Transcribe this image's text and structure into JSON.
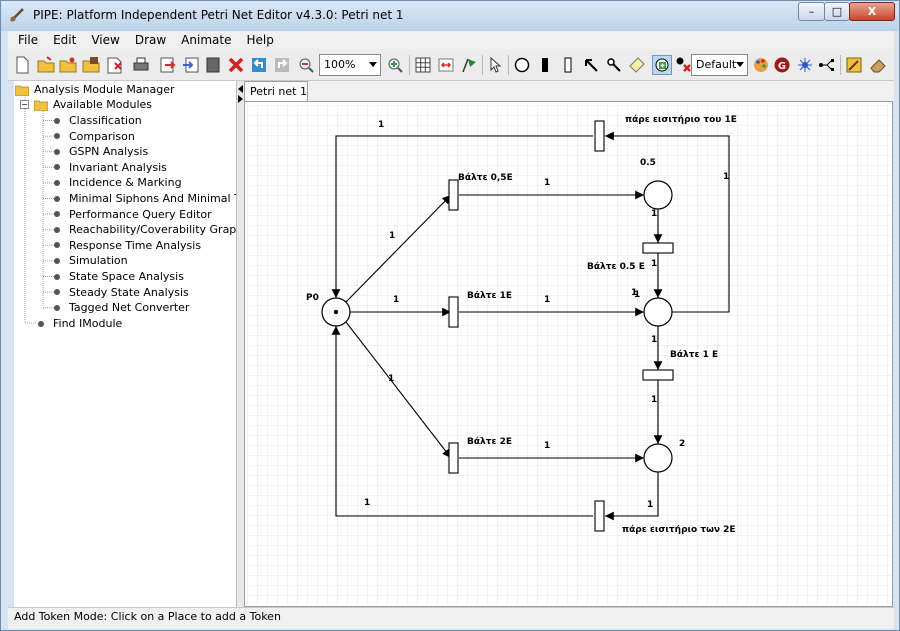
{
  "window": {
    "title": "PIPE: Platform Independent Petri Net Editor v4.3.0: Petri net 1",
    "minimize": "–",
    "maximize": "□",
    "close": "X"
  },
  "menu": [
    "File",
    "Edit",
    "View",
    "Draw",
    "Animate",
    "Help"
  ],
  "toolbar": {
    "zoom_value": "100%",
    "token_class": "Default",
    "colors": {
      "green_token_button": "#3a9b3a",
      "red_delete": "#d42020",
      "selected_tool_bg": "#bcd6ee"
    }
  },
  "tree": {
    "root": "Analysis Module Manager",
    "group": "Available Modules",
    "modules": [
      "Classification",
      "Comparison",
      "GSPN Analysis",
      "Invariant Analysis",
      "Incidence & Marking",
      "Minimal Siphons And Minimal Traps",
      "Performance Query Editor",
      "Reachability/Coverability Graph",
      "Response Time Analysis",
      "Simulation",
      "State Space Analysis",
      "Steady State Analysis",
      "Tagged Net Converter"
    ],
    "find": "Find IModule"
  },
  "tab": {
    "label": "Petri net 1"
  },
  "petri": {
    "places": [
      {
        "id": "P0",
        "label": "P0",
        "tokens": 1,
        "x": 0,
        "y": 0
      },
      {
        "id": "p05",
        "label": "0.5",
        "tokens": 0
      },
      {
        "id": "p1",
        "label": "1",
        "tokens": 0
      },
      {
        "id": "p2",
        "label": "2",
        "tokens": 0
      }
    ],
    "transitions": [
      {
        "id": "t_top",
        "label": "πάρε εισιτήριο του 1Ε"
      },
      {
        "id": "t_05",
        "label": "Βάλτε 0,5Ε"
      },
      {
        "id": "t_1",
        "label": "Βάλτε 1Ε"
      },
      {
        "id": "t_2",
        "label": "Βάλτε 2Ε"
      },
      {
        "id": "t_conv05",
        "label": "Βάλτε 0.5 Ε"
      },
      {
        "id": "t_conv1",
        "label": "Βάλτε 1 Ε"
      },
      {
        "id": "t_bottom",
        "label": "πάρε εισιτήριο των 2Ε"
      }
    ],
    "arc_weight": "1"
  },
  "status": {
    "text": "Add Token Mode: Click on a Place to add a Token"
  }
}
